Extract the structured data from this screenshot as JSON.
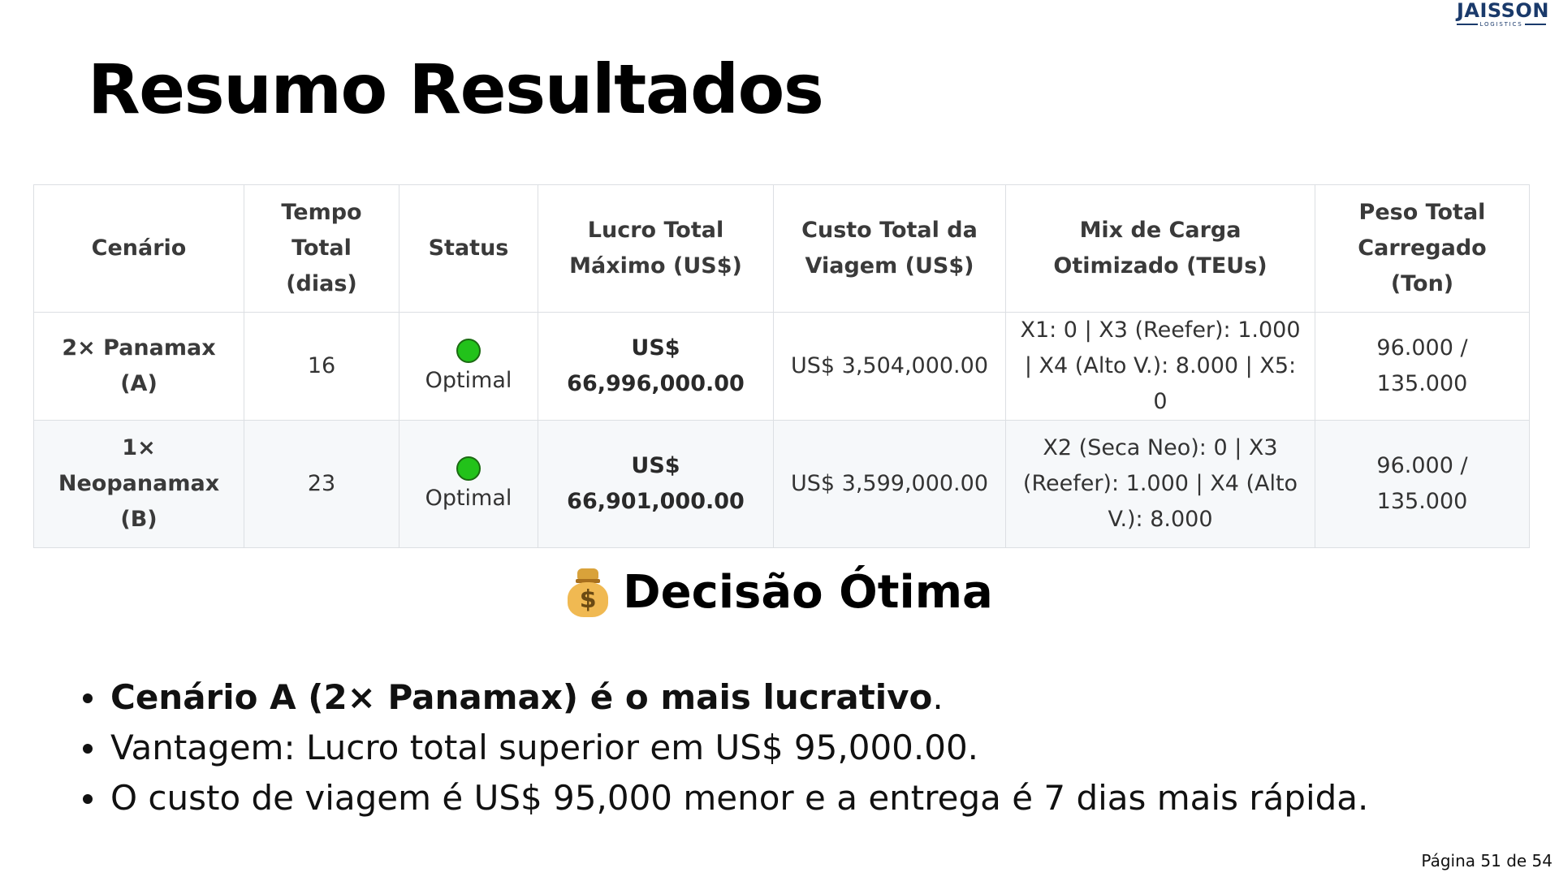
{
  "logo": {
    "brand": "JAISSON",
    "sub": "LOGISTICS"
  },
  "title": "Resumo Resultados",
  "table": {
    "headers": [
      "Cenário",
      "Tempo Total (dias)",
      "Status",
      "Lucro Total Máximo (US$)",
      "Custo Total da Viagem (US$)",
      "Mix de Carga Otimizado (TEUs)",
      "Peso Total Carregado (Ton)"
    ],
    "rows": [
      {
        "scenario": "2× Panamax (A)",
        "days": "16",
        "status": "Optimal",
        "profit": "US$ 66,996,000.00",
        "cost": "US$ 3,504,000.00",
        "mix": "X1: 0 | X3 (Reefer): 1.000 | X4 (Alto V.): 8.000 | X5: 0",
        "weight": "96.000 / 135.000"
      },
      {
        "scenario": "1× Neopanamax (B)",
        "days": "23",
        "status": "Optimal",
        "profit": "US$ 66,901,000.00",
        "cost": "US$ 3,599,000.00",
        "mix": "X2 (Seca Neo): 0 | X3 (Reefer): 1.000 | X4 (Alto V.): 8.000",
        "weight": "96.000 / 135.000"
      }
    ]
  },
  "decision": {
    "heading": "Decisão Ótima",
    "icon": "money-bag-icon"
  },
  "bullets": {
    "b1_bold": "Cenário A (2× Panamax) é o mais lucrativo",
    "b1_tail": ".",
    "b2": "Vantagem: Lucro total superior em US$ 95,000.00.",
    "b3": "O custo de viagem é US$ 95,000 menor e a entrega é 7 dias mais rápida."
  },
  "footer": {
    "page": "Página 51 de 54"
  },
  "colors": {
    "status_dot": "#22c21a",
    "logo": "#1a3a6b",
    "table_border": "#dcdfe3",
    "alt_row": "#f6f8fa"
  }
}
